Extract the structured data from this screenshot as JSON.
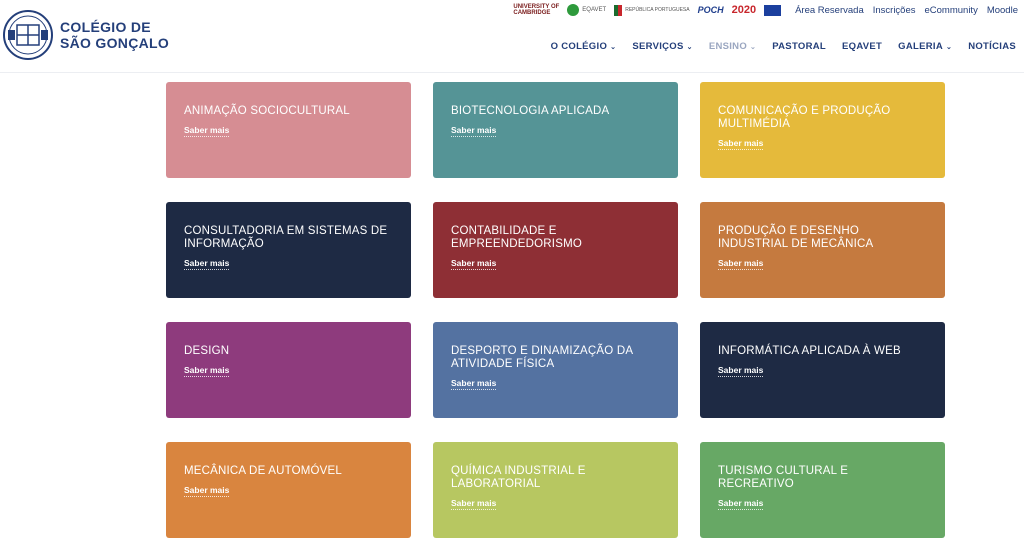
{
  "logo": {
    "line1": "COLÉGIO DE",
    "line2": "SÃO GONÇALO"
  },
  "partners": {
    "cambridge_line1": "UNIVERSITY OF",
    "cambridge_line2": "CAMBRIDGE",
    "eqavet": "EQAVET",
    "republica": "REPÚBLICA PORTUGUESA",
    "poch": "POCH",
    "portugal2020": "2020"
  },
  "top_links": [
    "Área Reservada",
    "Inscrições",
    "eCommunity",
    "Moodle"
  ],
  "nav": {
    "items": [
      {
        "label": "O COLÉGIO",
        "dropdown": true
      },
      {
        "label": "SERVIÇOS",
        "dropdown": true
      },
      {
        "label": "ENSINO",
        "dropdown": true,
        "active": true
      },
      {
        "label": "PASTORAL",
        "dropdown": false
      },
      {
        "label": "EQAVET",
        "dropdown": false
      },
      {
        "label": "GALERIA",
        "dropdown": true
      },
      {
        "label": "NOTÍCIAS",
        "dropdown": false
      }
    ]
  },
  "cards": [
    {
      "title": "ANIMAÇÃO SOCIOCULTURAL",
      "link": "Saber mais",
      "color": "#d68d93"
    },
    {
      "title": "BIOTECNOLOGIA APLICADA",
      "link": "Saber mais",
      "color": "#559496"
    },
    {
      "title": "COMUNICAÇÃO E PRODUÇÃO MULTIMÉDIA",
      "link": "Saber mais",
      "color": "#e5ba3b"
    },
    {
      "title": "CONSULTADORIA EM SISTEMAS DE INFORMAÇÃO",
      "link": "Saber mais",
      "color": "#1e2a44"
    },
    {
      "title": "CONTABILIDADE E EMPREENDEDORISMO",
      "link": "Saber mais",
      "color": "#8e2f35"
    },
    {
      "title": "PRODUÇÃO E DESENHO INDUSTRIAL DE MECÂNICA",
      "link": "Saber mais",
      "color": "#c57a3f"
    },
    {
      "title": "DESIGN",
      "link": "Saber mais",
      "color": "#8e3b7d"
    },
    {
      "title": "DESPORTO E DINAMIZAÇÃO DA ATIVIDADE FÍSICA",
      "link": "Saber mais",
      "color": "#5472a1"
    },
    {
      "title": "INFORMÁTICA APLICADA À WEB",
      "link": "Saber mais",
      "color": "#1e2a44"
    },
    {
      "title": "MECÂNICA DE AUTOMÓVEL",
      "link": "Saber mais",
      "color": "#d9853f"
    },
    {
      "title": "QUÍMICA INDUSTRIAL E LABORATORIAL",
      "link": "Saber mais",
      "color": "#b7c761"
    },
    {
      "title": "TURISMO CULTURAL E RECREATIVO",
      "link": "Saber mais",
      "color": "#67a865"
    }
  ]
}
